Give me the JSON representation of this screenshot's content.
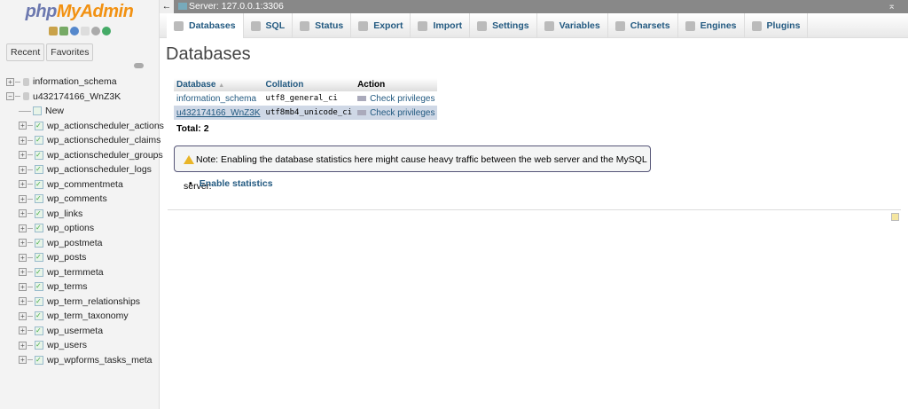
{
  "sidebar": {
    "logo_php": "php",
    "logo_my": "MyAdmin",
    "tabs": [
      "Recent",
      "Favorites"
    ],
    "databases": [
      {
        "name": "information_schema",
        "expanded": false
      },
      {
        "name": "u432174166_WnZ3K",
        "expanded": true
      }
    ],
    "new_label": "New",
    "tables": [
      "wp_actionscheduler_actions",
      "wp_actionscheduler_claims",
      "wp_actionscheduler_groups",
      "wp_actionscheduler_logs",
      "wp_commentmeta",
      "wp_comments",
      "wp_links",
      "wp_options",
      "wp_postmeta",
      "wp_posts",
      "wp_termmeta",
      "wp_terms",
      "wp_term_relationships",
      "wp_term_taxonomy",
      "wp_usermeta",
      "wp_users",
      "wp_wpforms_tasks_meta"
    ]
  },
  "topbar": {
    "back": "←",
    "server": "Server: 127.0.0.1:3306",
    "collapse": "⌅"
  },
  "tabs": [
    "Databases",
    "SQL",
    "Status",
    "Export",
    "Import",
    "Settings",
    "Variables",
    "Charsets",
    "Engines",
    "Plugins"
  ],
  "main": {
    "title": "Databases",
    "table": {
      "headers": [
        "Database",
        "Collation",
        "Action"
      ],
      "sort_indicator": "▲",
      "rows": [
        {
          "db": "information_schema",
          "collation": "utf8_general_ci",
          "action": "Check privileges"
        },
        {
          "db": "u432174166_WnZ3K",
          "collation": "utf8mb4_unicode_ci",
          "action": "Check privileges"
        }
      ]
    },
    "total": "Total: 2",
    "note": "Note: Enabling the database statistics here might cause heavy traffic between the web server and the MySQL server.",
    "enable_stats": "Enable statistics"
  }
}
